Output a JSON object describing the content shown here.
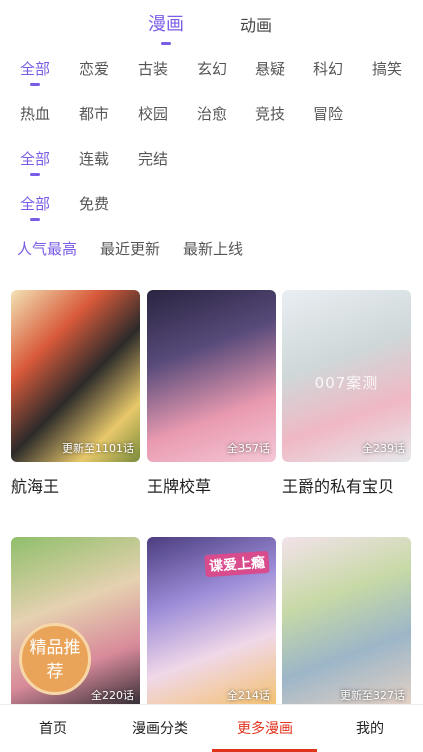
{
  "header": {
    "tabs": [
      {
        "label": "漫画",
        "active": true
      },
      {
        "label": "动画",
        "active": false
      }
    ]
  },
  "filters": {
    "genre": [
      "全部",
      "恋爱",
      "古装",
      "玄幻",
      "悬疑",
      "科幻",
      "搞笑",
      "热血",
      "都市",
      "校园",
      "治愈",
      "竞技",
      "冒险"
    ],
    "status": [
      "全部",
      "连载",
      "完结"
    ],
    "price": [
      "全部",
      "免费"
    ],
    "sort": [
      "人气最高",
      "最近更新",
      "最新上线"
    ]
  },
  "comics": [
    {
      "title": "航海王",
      "count": "更新至1101话"
    },
    {
      "title": "王牌校草",
      "count": "全357话"
    },
    {
      "title": "王爵的私有宝贝",
      "count": "全239话",
      "watermark": "007案测"
    },
    {
      "title": "",
      "count": "全220话",
      "badge": "精品推荐"
    },
    {
      "title": "",
      "count": "全214话",
      "logo": "谍爱上瘾"
    },
    {
      "title": "",
      "count": "更新至327话"
    }
  ],
  "bottom_nav": [
    {
      "label": "首页",
      "active": false
    },
    {
      "label": "漫画分类",
      "active": false
    },
    {
      "label": "更多漫画",
      "active": true
    },
    {
      "label": "我的",
      "active": false
    }
  ],
  "colors": {
    "accent": "#7b5ce6",
    "nav_active": "#e0331c"
  }
}
